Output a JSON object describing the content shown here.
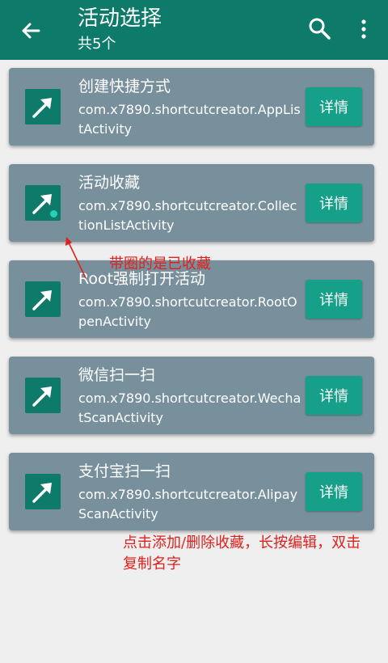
{
  "appbar": {
    "title": "活动选择",
    "subtitle": "共5个",
    "background": "#0e7a6a",
    "icons": [
      "arrow-back-icon",
      "search-icon",
      "more-vert-icon"
    ]
  },
  "cards": [
    {
      "name": "创建快捷方式",
      "package": "com.x7890.shortcutcreator.AppListActivity",
      "button": "详情",
      "favorited": false
    },
    {
      "name": "活动收藏",
      "package": "com.x7890.shortcutcreator.CollectionListActivity",
      "button": "详情",
      "favorited": true
    },
    {
      "name": "Root强制打开活动",
      "package": "com.x7890.shortcutcreator.RootOpenActivity",
      "button": "详情",
      "favorited": false
    },
    {
      "name": "微信扫一扫",
      "package": "com.x7890.shortcutcreator.WechatScanActivity",
      "button": "详情",
      "favorited": false
    },
    {
      "name": "支付宝扫一扫",
      "package": "com.x7890.shortcutcreator.AlipayScanActivity",
      "button": "详情",
      "favorited": false
    }
  ],
  "annotations": {
    "favorite_note": "带圈的是已收藏",
    "usage_note": "点击添加/删除收藏，长按编辑，双击复制名字"
  },
  "colors": {
    "card": "#78909c",
    "accent": "#16a08a",
    "annotation": "#e0201c"
  }
}
